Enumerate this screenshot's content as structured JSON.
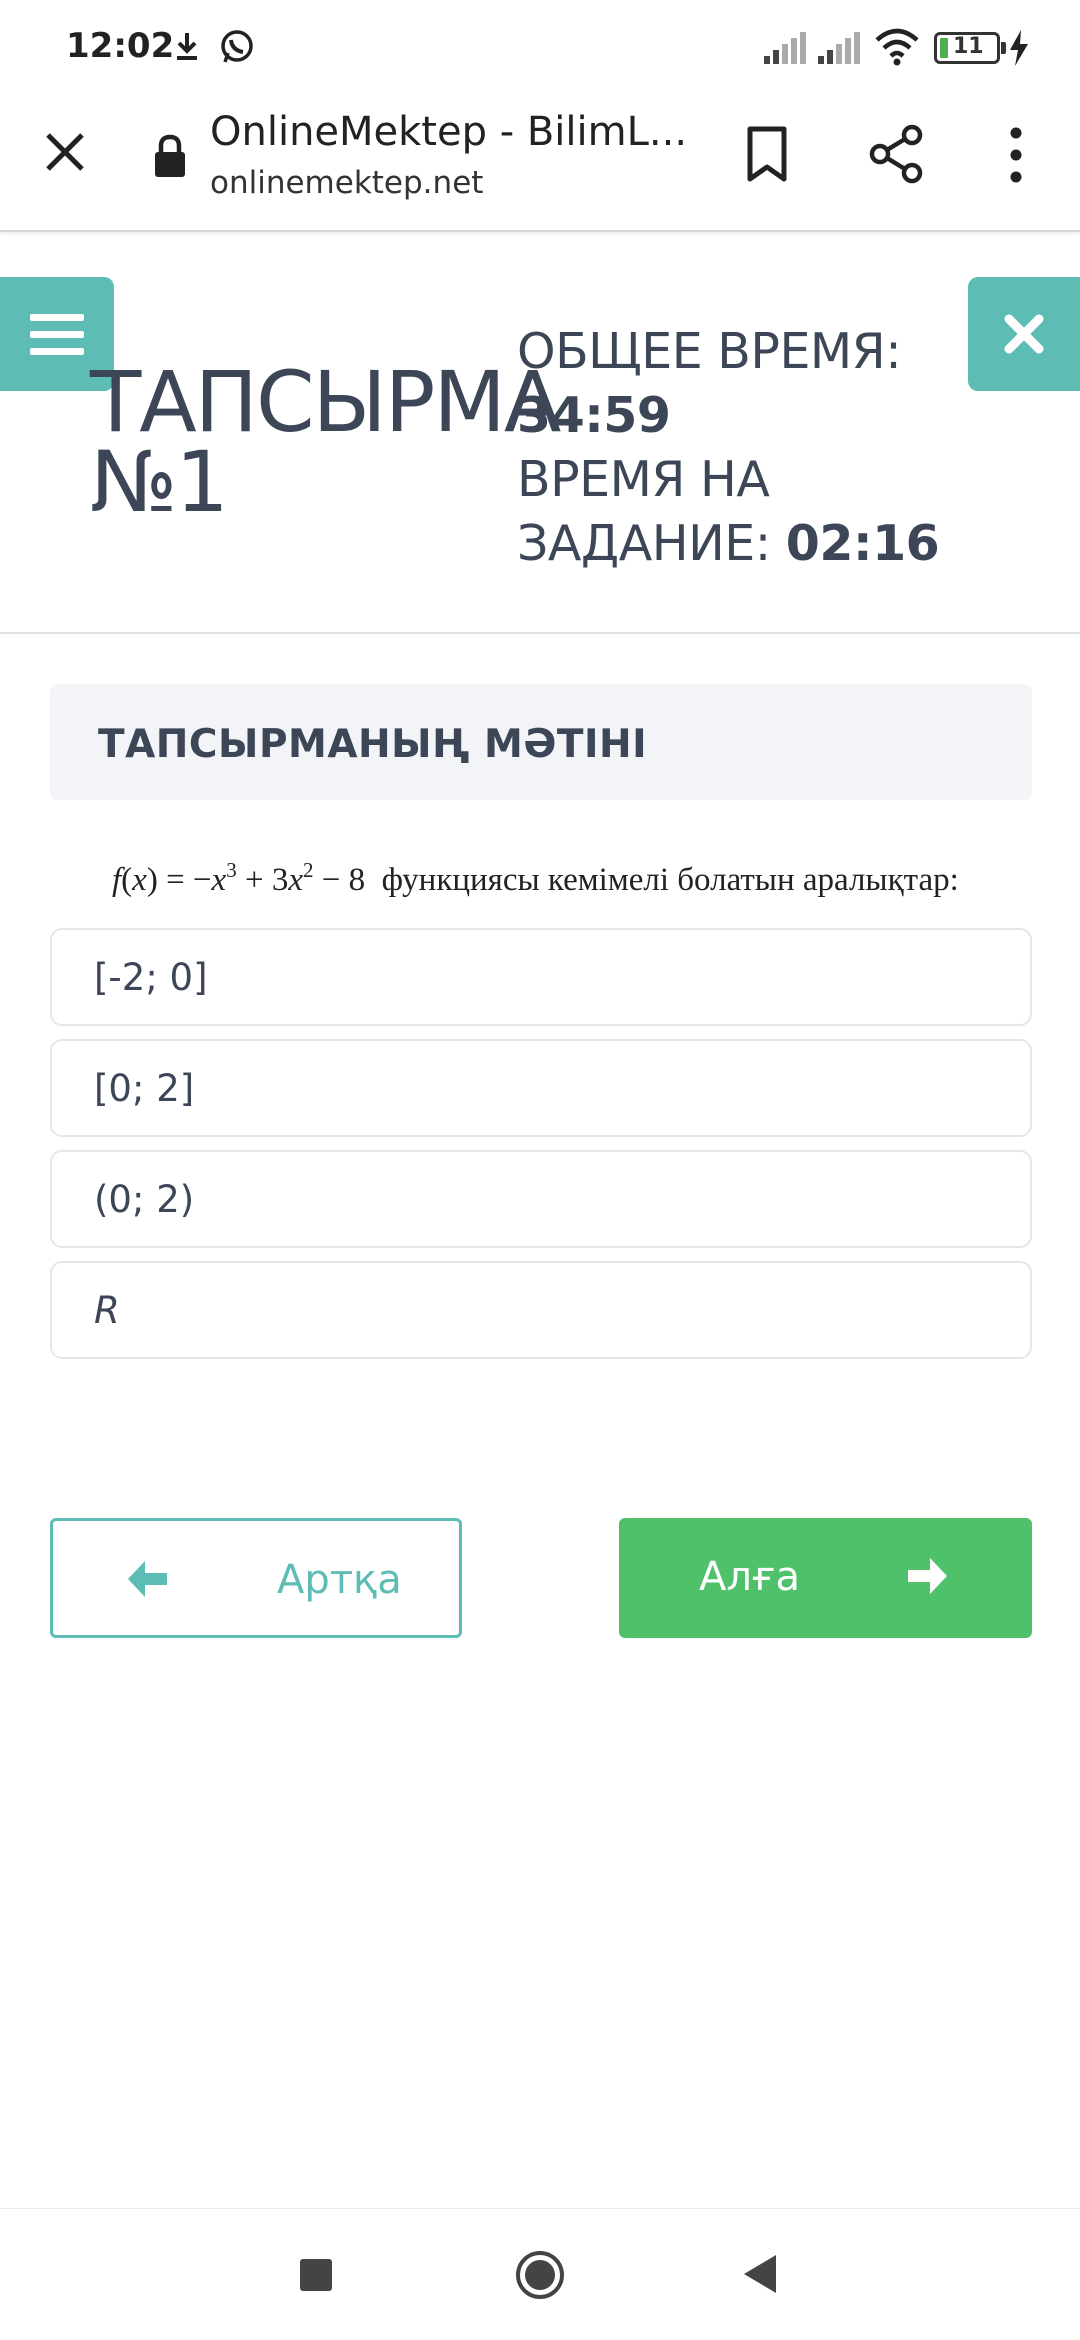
{
  "status_bar": {
    "time": "12:02",
    "battery": "11",
    "icons": [
      "download-icon",
      "whatsapp-icon",
      "signal-icon",
      "signal-icon",
      "wifi-icon",
      "battery-icon",
      "charging-icon"
    ]
  },
  "browser": {
    "title": "OnlineMektep - BilimL...",
    "url": "onlinemektep.net",
    "icons": [
      "close-icon",
      "lock-icon",
      "bookmark-icon",
      "share-icon",
      "more-vert-icon"
    ]
  },
  "header": {
    "task_title_line1": "ТАПСЫРМА",
    "task_title_line2": "№1",
    "total_time_label": "ОБЩЕЕ ВРЕМЯ:",
    "total_time_value": "34:59",
    "task_time_label_line1": "ВРЕМЯ НА",
    "task_time_label_line2": "ЗАДАНИЕ:",
    "task_time_value": "02:16"
  },
  "task": {
    "section_label": "ТАПСЫРМАНЫҢ МӘТІНІ",
    "question_text": "функциясы кемімелі болатын аралықтар:",
    "options": [
      {
        "label": "[-2; 0]",
        "italic": false
      },
      {
        "label": "[0; 2]",
        "italic": false
      },
      {
        "label": "(0; 2)",
        "italic": false
      },
      {
        "label": "R",
        "italic": true
      }
    ]
  },
  "navigation": {
    "back_label": "Артқа",
    "next_label": "Алға"
  },
  "colors": {
    "teal": "#5dbcb4",
    "green": "#4fc16a",
    "text": "#3c4656",
    "panel": "#f2f4f7"
  }
}
